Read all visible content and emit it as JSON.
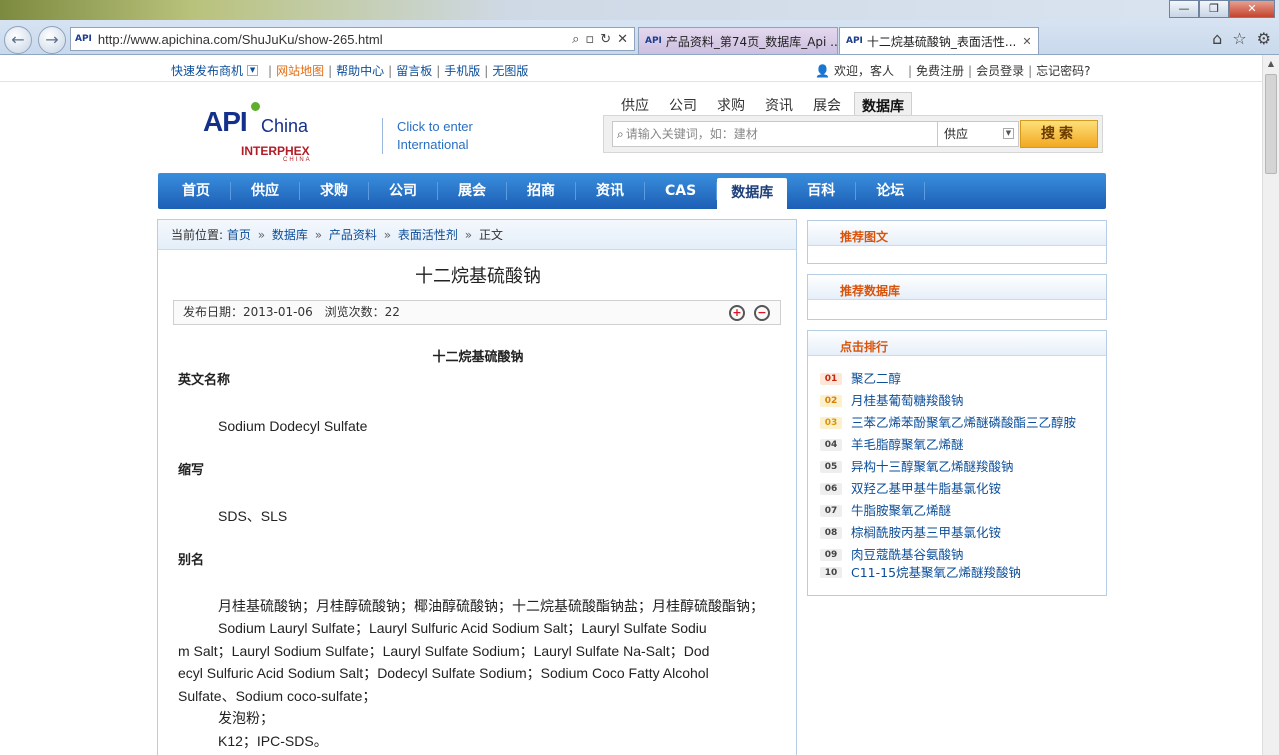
{
  "browser": {
    "url": "http://www.apichina.com/ShuJuKu/show-265.html",
    "tabs": [
      {
        "title": "产品资料_第74页_数据库_Api ...",
        "active": false
      },
      {
        "title": "十二烷基硫酸钠_表面活性...",
        "active": true
      }
    ],
    "window_buttons": {
      "minimize": "—",
      "maximize": "❐",
      "close": "✕"
    },
    "site_icon": "API"
  },
  "toplinks": {
    "left": [
      "快速发布商机",
      "网站地图",
      "帮助中心",
      "留言板",
      "手机版",
      "无图版"
    ],
    "welcome": "欢迎，客人",
    "right": [
      "免费注册",
      "会员登录",
      "忘记密码?"
    ]
  },
  "logo": {
    "api": "API",
    "china": "China",
    "interphex": "INTERPHEX",
    "interphex_sub": "CHINA"
  },
  "international": {
    "line1": "Click to enter",
    "line2": "International"
  },
  "search": {
    "tabs": [
      "供应",
      "公司",
      "求购",
      "资讯",
      "展会",
      "数据库"
    ],
    "active_tab": "数据库",
    "placeholder": "请输入关键词，如：建材",
    "select_value": "供应",
    "button": "搜索"
  },
  "mainnav": {
    "items": [
      "首页",
      "供应",
      "求购",
      "公司",
      "展会",
      "招商",
      "资讯",
      "CAS",
      "数据库",
      "百科",
      "论坛"
    ],
    "active": "数据库"
  },
  "breadcrumb": {
    "label": "当前位置:",
    "items": [
      "首页",
      "数据库",
      "产品资料",
      "表面活性剂"
    ],
    "current": "正文",
    "arrow": "»"
  },
  "article": {
    "title": "十二烷基硫酸钠",
    "publish_label": "发布日期：",
    "publish_date": "2013-01-06",
    "views_label": "浏览次数：",
    "views": "22",
    "sub_title": "十二烷基硫酸钠",
    "sec_english": "英文名称",
    "english_name": "Sodium Dodecyl Sulfate",
    "sec_abbr": "缩写",
    "abbr": "SDS、SLS",
    "sec_alias": "别名",
    "alias_cn": "月桂基硫酸钠；月桂醇硫酸钠；椰油醇硫酸钠；十二烷基硫酸酯钠盐；月桂醇硫酸酯钠；",
    "alias_en_l1": "Sodium Lauryl Sulfate；Lauryl Sulfuric Acid Sodium Salt；Lauryl Sulfate Sodiu",
    "alias_en_l2": "m Salt；Lauryl Sodium Sulfate；Lauryl Sulfate Sodium；Lauryl Sulfate Na-Salt；Dod",
    "alias_en_l3": "ecyl Sulfuric Acid Sodium Salt；Dodecyl Sulfate Sodium；Sodium Coco Fatty Alcohol",
    "alias_en_l4": "Sulfate、Sodium coco-sulfate；",
    "alias_foam": "发泡粉；",
    "alias_k12": "K12；IPC-SDS。"
  },
  "sidebar": {
    "box1": "推荐图文",
    "box2": "推荐数据库",
    "box3": "点击排行",
    "ranking": [
      {
        "num": "01",
        "name": "聚乙二醇"
      },
      {
        "num": "02",
        "name": "月桂基葡萄糖羧酸钠"
      },
      {
        "num": "03",
        "name": "三苯乙烯苯酚聚氧乙烯醚磷酸酯三乙醇胺"
      },
      {
        "num": "04",
        "name": "羊毛脂醇聚氧乙烯醚"
      },
      {
        "num": "05",
        "name": "异构十三醇聚氧乙烯醚羧酸钠"
      },
      {
        "num": "06",
        "name": "双羟乙基甲基牛脂基氯化铵"
      },
      {
        "num": "07",
        "name": "牛脂胺聚氧乙烯醚"
      },
      {
        "num": "08",
        "name": "棕榈酰胺丙基三甲基氯化铵"
      },
      {
        "num": "09",
        "name": "肉豆蔻酰基谷氨酸钠"
      },
      {
        "num": "10",
        "name": "C11-15烷基聚氧乙烯醚羧酸钠"
      }
    ]
  }
}
